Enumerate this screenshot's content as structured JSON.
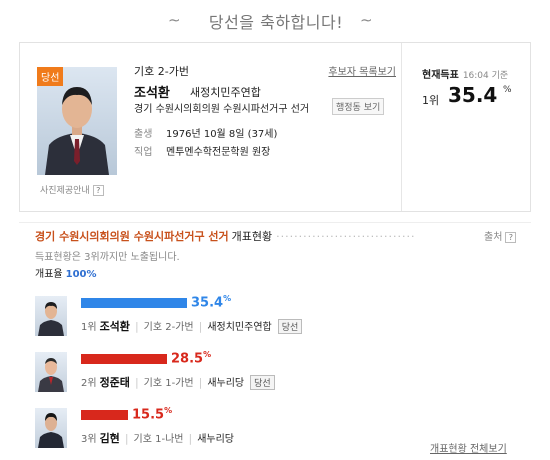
{
  "banner": {
    "title": "당선을 축하합니다!"
  },
  "winner": {
    "badge": "당선",
    "photo_caption": "사진제공안내",
    "symbol": "기호 2-가번",
    "list_link": "후보자 목록보기",
    "name": "조석환",
    "party": "새정치민주연합",
    "district": "경기 수원시의회의원 수원시파선거구 선거",
    "dong_button": "행정동 보기",
    "birth_label": "출생",
    "birth_value": "1976년 10월 8일 (37세)",
    "job_label": "직업",
    "job_value": "멘투멘수학전문학원 원장"
  },
  "current": {
    "label": "현재득표",
    "time": "16:04 기준",
    "rank": "1위",
    "percent": "35.4",
    "percent_sign": "%"
  },
  "results": {
    "org": "경기 수원시의회의원 수원시파선거구 선거",
    "tail": "개표현황",
    "source": "출처",
    "note": "득표현황은 3위까지만 노출됩니다.",
    "rate_label": "개표율",
    "rate_value": "100%",
    "candidates": [
      {
        "pct": "35.4",
        "pct_sign": "%",
        "share": 35.4,
        "color": "#2f86e8",
        "rank": "1위",
        "name": "조석환",
        "symbol": "기호 2-가번",
        "party": "새정치민주연합",
        "win": "당선"
      },
      {
        "pct": "28.5",
        "pct_sign": "%",
        "share": 28.5,
        "color": "#d8281c",
        "rank": "2위",
        "name": "정준태",
        "symbol": "기호 1-가번",
        "party": "새누리당",
        "win": "당선"
      },
      {
        "pct": "15.5",
        "pct_sign": "%",
        "share": 15.5,
        "color": "#d8281c",
        "rank": "3위",
        "name": "김현",
        "symbol": "기호 1-나번",
        "party": "새누리당",
        "win": ""
      }
    ],
    "full_link": "개표현황 전체보기"
  }
}
